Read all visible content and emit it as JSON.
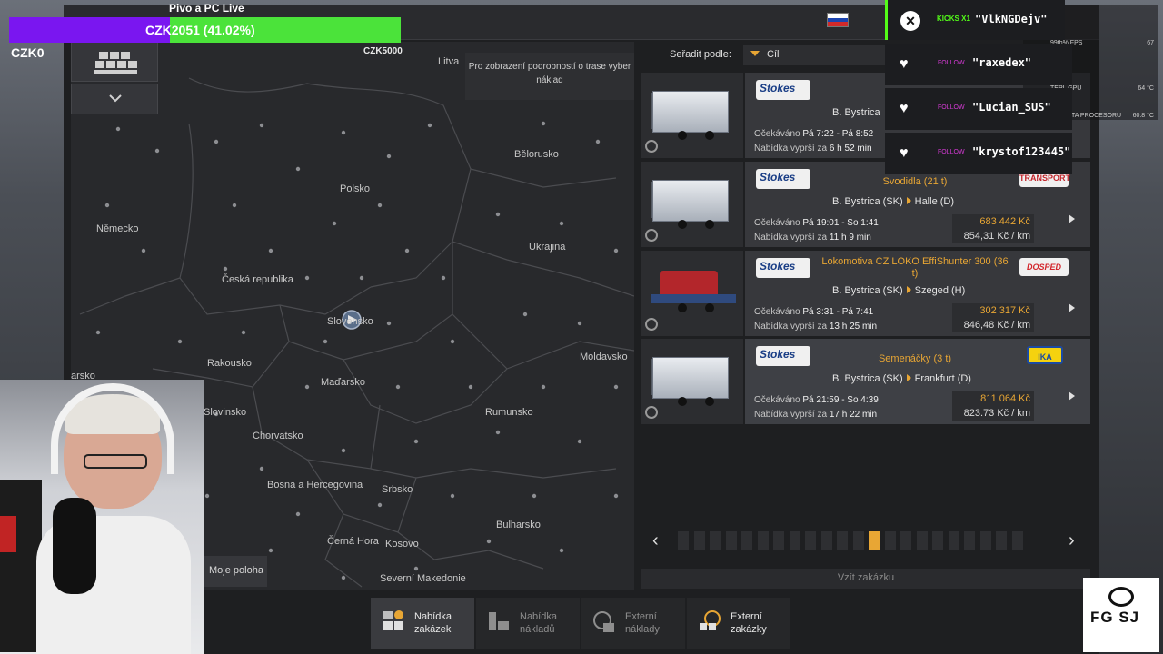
{
  "stream": {
    "title": "Pivo a PC Live",
    "donation_text": "CZK2051 (41.02%)",
    "donation_goal": "CZK5000",
    "donation_start": "CZK0",
    "donation_progress": 0.4102
  },
  "alerts": [
    {
      "type": "kicks",
      "tag": "KICKS X1",
      "name": "\"VlkNGDejv\""
    },
    {
      "type": "follow",
      "tag": "FOLLOW",
      "name": "\"raxedex\""
    },
    {
      "type": "follow",
      "tag": "FOLLOW",
      "name": "\"Lucian_SUS\""
    },
    {
      "type": "follow",
      "tag": "FOLLOW",
      "name": "\"krystof123445\""
    }
  ],
  "perf_overlay": [
    {
      "label": "",
      "value": "67"
    },
    {
      "label": "99th% FPS",
      "value": "67"
    },
    {
      "label": "VYUŽ GPU",
      "value": ""
    },
    {
      "label": "TEPL GPU",
      "value": "64 °C"
    },
    {
      "label": "VYUŽ CPU",
      "value": ""
    },
    {
      "label": "TEPLOTA PROCESORU",
      "value": "60.8 °C"
    }
  ],
  "map": {
    "hint": "Pro zobrazení podrobností o trase vyber náklad",
    "my_position": "Moje poloha",
    "labels": [
      {
        "text": "Litva",
        "id": "litva"
      },
      {
        "text": "Bělorusko",
        "id": "belorusko"
      },
      {
        "text": "Polsko",
        "id": "polsko"
      },
      {
        "text": "Německo",
        "id": "nemecko"
      },
      {
        "text": "Ukrajina",
        "id": "ukrajina"
      },
      {
        "text": "Česká republika",
        "id": "ceska"
      },
      {
        "text": "Slovensko",
        "id": "slovensko"
      },
      {
        "text": "Rakousko",
        "id": "rakousko"
      },
      {
        "text": "Maďarsko",
        "id": "madarsko"
      },
      {
        "text": "Moldavsko",
        "id": "moldavsko"
      },
      {
        "text": "arsko",
        "id": "arsko"
      },
      {
        "text": "Slovinsko",
        "id": "slovinsko"
      },
      {
        "text": "Rumunsko",
        "id": "rumunsko"
      },
      {
        "text": "Chorvatsko",
        "id": "chorvatsko"
      },
      {
        "text": "Bosna a Hercegovina",
        "id": "bosna"
      },
      {
        "text": "Srbsko",
        "id": "srbsko"
      },
      {
        "text": "Bulharsko",
        "id": "bulharsko"
      },
      {
        "text": "Černá Hora",
        "id": "cerna"
      },
      {
        "text": "Kosovo",
        "id": "kosovo"
      },
      {
        "text": "Severní Makedonie",
        "id": "makedonie"
      }
    ]
  },
  "sort": {
    "label": "Seřadit podle:",
    "value": "Cíl"
  },
  "jobs": [
    {
      "company": "Stokes",
      "cargo": "",
      "origin": "B. Bystrica",
      "destination": "",
      "expected_label": "Očekáváno",
      "expected": "Pá 7:22 - Pá 8:52",
      "expires_label": "Nabídka vyprší za",
      "expires": "6 h 52 min",
      "pay": "",
      "rate": ""
    },
    {
      "company": "Stokes",
      "cargo": "Svodidla (21 t)",
      "origin": "B. Bystrica (SK)",
      "destination": "Halle (D)",
      "expected_label": "Očekáváno",
      "expected": "Pá 19:01 - So 1:41",
      "expires_label": "Nabídka vyprší za",
      "expires": "11 h 9 min",
      "pay": "683 442 Kč",
      "rate": "854,31 Kč / km",
      "client": "TRANSPORT"
    },
    {
      "company": "Stokes",
      "cargo": "Lokomotiva CZ LOKO EffiShunter 300 (36 t)",
      "origin": "B. Bystrica (SK)",
      "destination": "Szeged (H)",
      "expected_label": "Očekáváno",
      "expected": "Pá 3:31 - Pá 7:41",
      "expires_label": "Nabídka vyprší za",
      "expires": "13 h 25 min",
      "pay": "302 317 Kč",
      "rate": "846,48 Kč / km",
      "client": "DOSPED"
    },
    {
      "company": "Stokes",
      "cargo": "Semenáčky (3 t)",
      "origin": "B. Bystrica (SK)",
      "destination": "Frankfurt (D)",
      "expected_label": "Očekáváno",
      "expected": "Pá 21:59 - So 4:39",
      "expires_label": "Nabídka vyprší za",
      "expires": "17 h 22 min",
      "pay": "811 064 Kč",
      "rate": "823.73 Kč / km",
      "client": "IKA"
    }
  ],
  "take_button": "Vzít zakázku",
  "tabs": [
    {
      "line1": "Nabídka",
      "line2": "zakázek"
    },
    {
      "line1": "Nabídka",
      "line2": "nákladů"
    },
    {
      "line1": "Externí",
      "line2": "náklady"
    },
    {
      "line1": "Externí",
      "line2": "zakázky"
    }
  ],
  "logo": {
    "text": "FG  SJ"
  },
  "colors": {
    "accent": "#e8a634",
    "kick_green": "#53fc18",
    "donation_purple": "#7a16f0",
    "donation_green": "#4be33a"
  }
}
